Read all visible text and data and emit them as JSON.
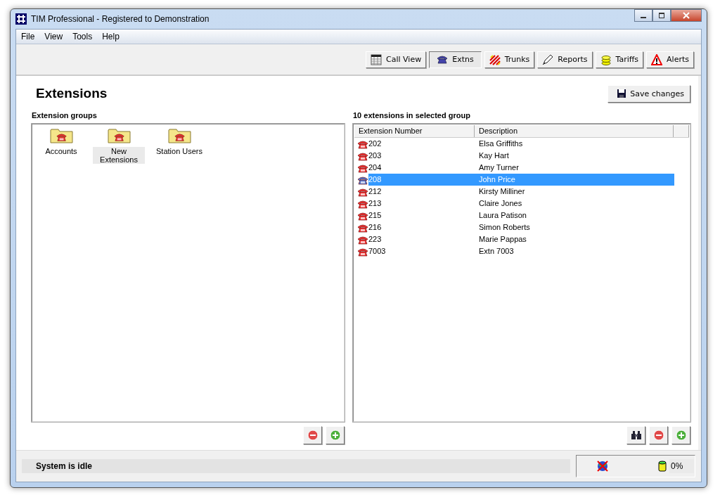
{
  "window": {
    "title": "TIM Professional - Registered to Demonstration"
  },
  "menu": [
    "File",
    "View",
    "Tools",
    "Help"
  ],
  "toolbar": [
    {
      "label": "Call View",
      "kind": "grid",
      "selected": false
    },
    {
      "label": "Extns",
      "kind": "phone",
      "selected": true
    },
    {
      "label": "Trunks",
      "kind": "stripes",
      "selected": false
    },
    {
      "label": "Reports",
      "kind": "pen",
      "selected": false
    },
    {
      "label": "Tariffs",
      "kind": "coins",
      "selected": false
    },
    {
      "label": "Alerts",
      "kind": "warning",
      "selected": false
    }
  ],
  "page": {
    "heading": "Extensions",
    "save_button": "Save changes"
  },
  "groups": {
    "label": "Extension groups",
    "items": [
      {
        "label": "Accounts",
        "selected": false
      },
      {
        "label": "New Extensions",
        "selected": true
      },
      {
        "label": "Station Users",
        "selected": false
      }
    ]
  },
  "extensions": {
    "label": "10 extensions in selected group",
    "columns": [
      "Extension Number",
      "Description"
    ],
    "rows": [
      {
        "number": "202",
        "description": "Elsa Griffiths",
        "selected": false
      },
      {
        "number": "203",
        "description": "Kay Hart",
        "selected": false
      },
      {
        "number": "204",
        "description": "Amy Turner",
        "selected": false
      },
      {
        "number": "208",
        "description": "John Price",
        "selected": true
      },
      {
        "number": "212",
        "description": "Kirsty Milliner",
        "selected": false
      },
      {
        "number": "213",
        "description": "Claire Jones",
        "selected": false
      },
      {
        "number": "215",
        "description": "Laura Patison",
        "selected": false
      },
      {
        "number": "216",
        "description": "Simon Roberts",
        "selected": false
      },
      {
        "number": "223",
        "description": "Marie Pappas",
        "selected": false
      },
      {
        "number": "7003",
        "description": "Extn 7003",
        "selected": false
      }
    ]
  },
  "status_bar": {
    "message": "System is idle",
    "usage": "0%"
  }
}
